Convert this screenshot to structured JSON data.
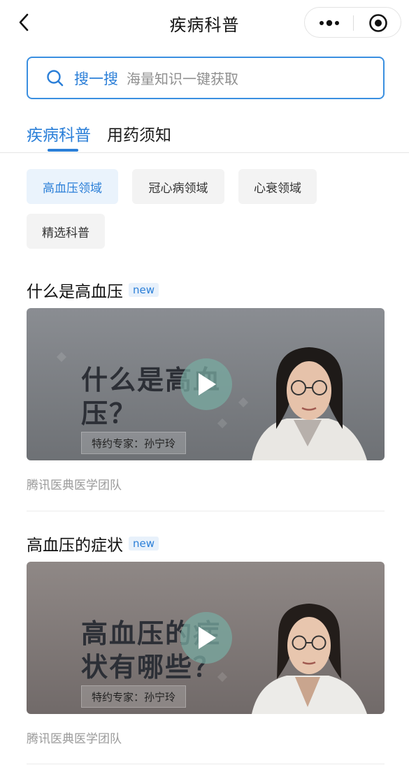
{
  "navbar": {
    "title": "疾病科普",
    "back_icon": "chevron-left-icon",
    "more_icon": "more-dots-icon",
    "close_icon": "target-close-icon"
  },
  "search": {
    "label": "搜一搜",
    "placeholder": "海量知识一键获取",
    "icon": "search-icon",
    "accent": "#3a8fe0"
  },
  "tabs": [
    {
      "label": "疾病科普",
      "active": true
    },
    {
      "label": "用药须知",
      "active": false
    }
  ],
  "chips": [
    {
      "label": "高血压领域",
      "active": true
    },
    {
      "label": "冠心病领域",
      "active": false
    },
    {
      "label": "心衰领域",
      "active": false
    },
    {
      "label": "精选科普",
      "active": false
    }
  ],
  "articles": [
    {
      "title": "什么是高血压",
      "badge": "new",
      "video_text_line1": "什么是高血",
      "video_text_line2": "压？",
      "expert_label": "特约专家：孙宁玲",
      "source": "腾讯医典医学团队"
    },
    {
      "title": "高血压的症状",
      "badge": "new",
      "video_text_line1": "高血压的症",
      "video_text_line2": "状有哪些？",
      "expert_label": "特约专家：孙宁玲",
      "source": "腾讯医典医学团队"
    }
  ],
  "colors": {
    "accent": "#2b7fd8",
    "chip_bg": "#f3f3f3",
    "chip_active_bg": "#eaf3fc"
  }
}
